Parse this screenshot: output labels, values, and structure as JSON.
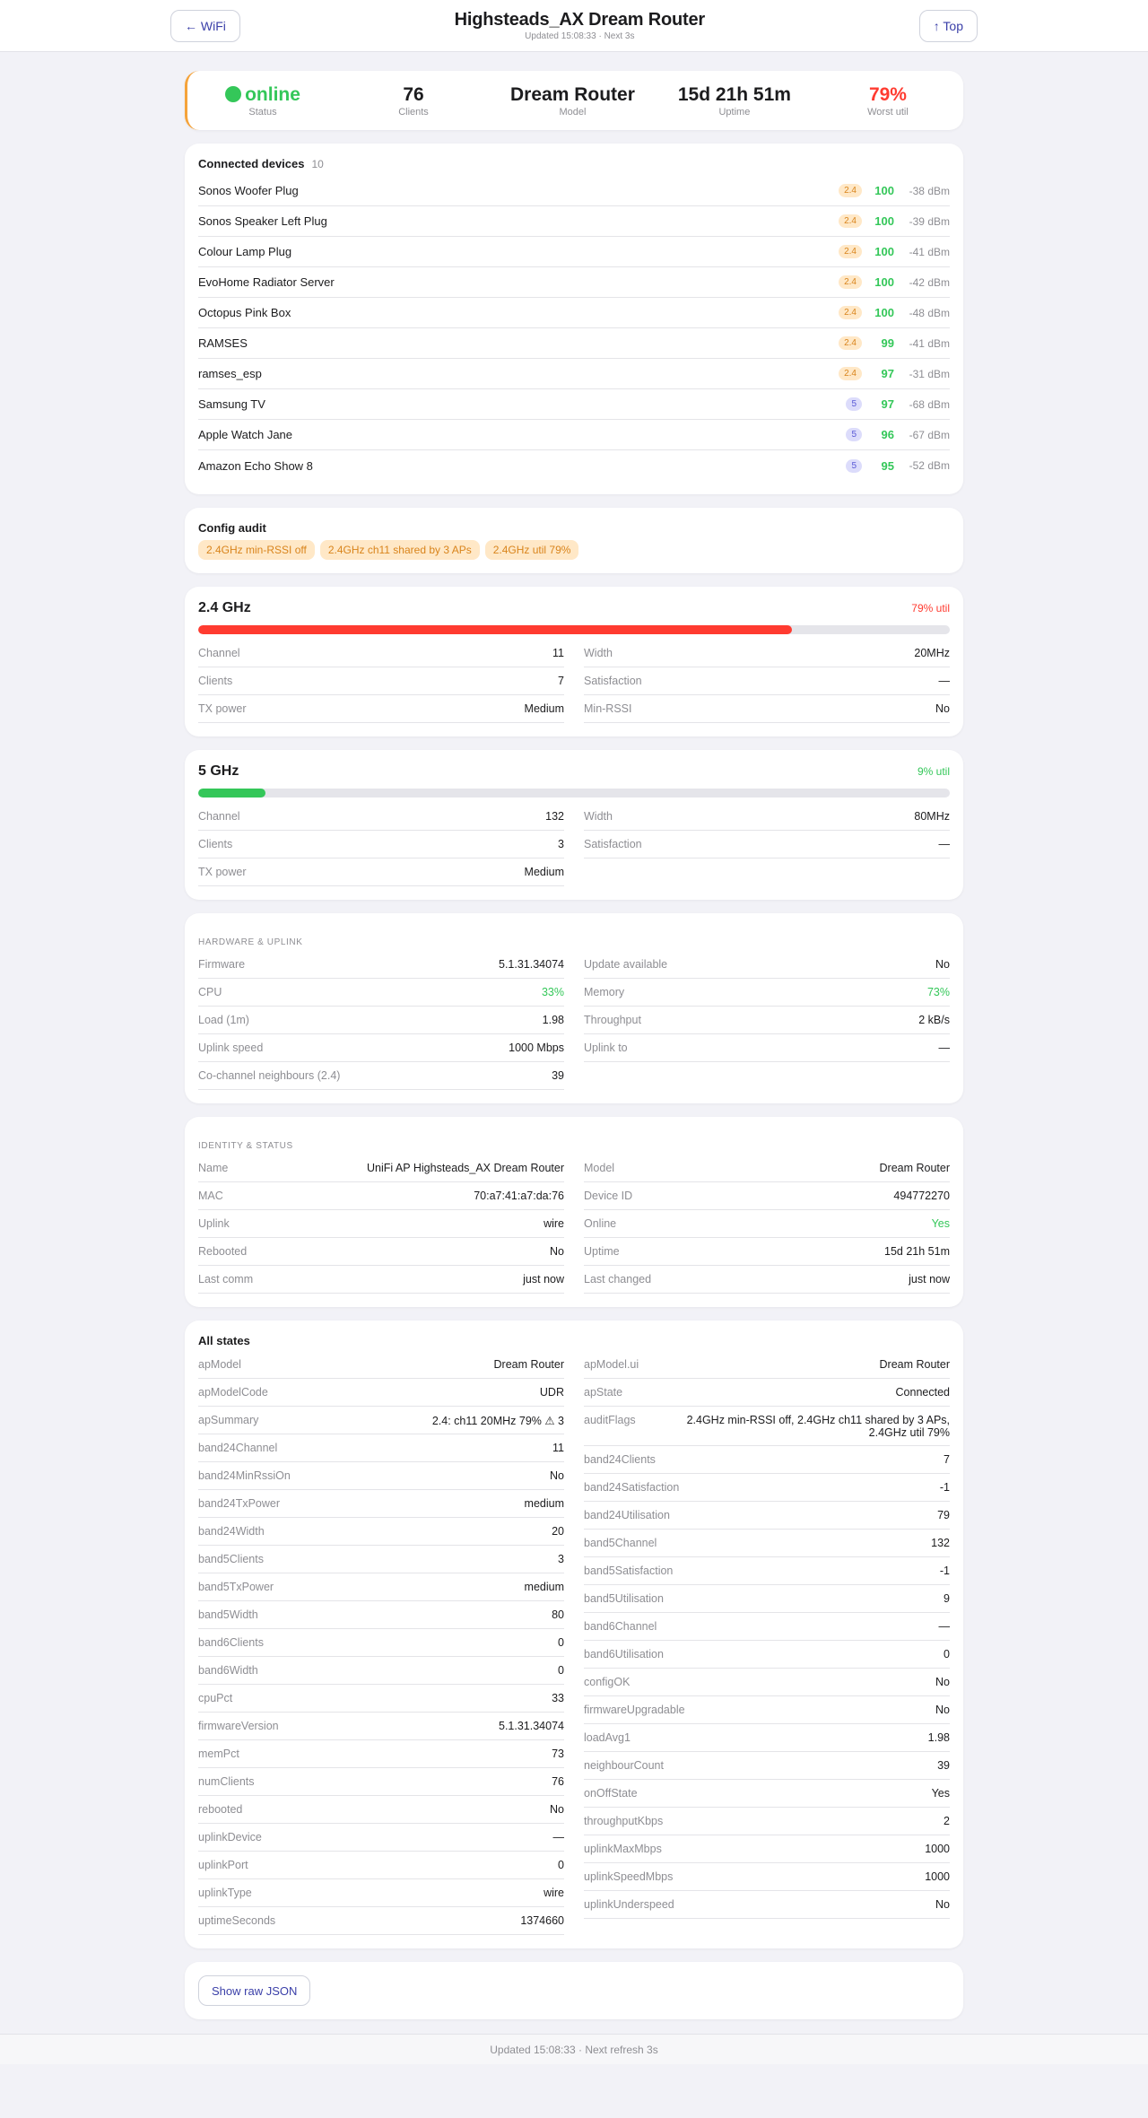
{
  "header": {
    "back_label": "← WiFi",
    "title": "Highsteads_AX Dream Router",
    "subtitle": "Updated 15:08:33 · Next 3s",
    "top_label": "↑ Top"
  },
  "summary": {
    "status_value": "online",
    "status_label": "Status",
    "clients_value": "76",
    "clients_label": "Clients",
    "model_value": "Dream Router",
    "model_label": "Model",
    "uptime_value": "15d 21h 51m",
    "uptime_label": "Uptime",
    "util_value": "79%",
    "util_label": "Worst util"
  },
  "devices": {
    "title": "Connected devices",
    "count": "10",
    "items": [
      {
        "name": "Sonos Woofer Plug",
        "band": "2.4",
        "sat": "100",
        "rssi": "-38 dBm"
      },
      {
        "name": "Sonos Speaker Left Plug",
        "band": "2.4",
        "sat": "100",
        "rssi": "-39 dBm"
      },
      {
        "name": "Colour Lamp Plug",
        "band": "2.4",
        "sat": "100",
        "rssi": "-41 dBm"
      },
      {
        "name": "EvoHome Radiator Server",
        "band": "2.4",
        "sat": "100",
        "rssi": "-42 dBm"
      },
      {
        "name": "Octopus Pink Box",
        "band": "2.4",
        "sat": "100",
        "rssi": "-48 dBm"
      },
      {
        "name": "RAMSES",
        "band": "2.4",
        "sat": "99",
        "rssi": "-41 dBm"
      },
      {
        "name": "ramses_esp",
        "band": "2.4",
        "sat": "97",
        "rssi": "-31 dBm"
      },
      {
        "name": "Samsung TV",
        "band": "5",
        "sat": "97",
        "rssi": "-68 dBm"
      },
      {
        "name": "Apple Watch Jane",
        "band": "5",
        "sat": "96",
        "rssi": "-67 dBm"
      },
      {
        "name": "Amazon Echo Show 8",
        "band": "5",
        "sat": "95",
        "rssi": "-52 dBm"
      }
    ]
  },
  "audit": {
    "title": "Config audit",
    "chips": [
      "2.4GHz min-RSSI off",
      "2.4GHz ch11 shared by 3 APs",
      "2.4GHz util 79%"
    ]
  },
  "band24": {
    "title": "2.4 GHz",
    "util_label": "79% util",
    "util_pct": 79,
    "bar_color": "#ff3b30",
    "left": [
      {
        "k": "Channel",
        "v": "11"
      },
      {
        "k": "Clients",
        "v": "7"
      },
      {
        "k": "TX power",
        "v": "Medium"
      }
    ],
    "right": [
      {
        "k": "Width",
        "v": "20MHz"
      },
      {
        "k": "Satisfaction",
        "v": "—"
      },
      {
        "k": "Min-RSSI",
        "v": "No"
      }
    ]
  },
  "band5": {
    "title": "5 GHz",
    "util_label": "9% util",
    "util_pct": 9,
    "bar_color": "#34c759",
    "left": [
      {
        "k": "Channel",
        "v": "132"
      },
      {
        "k": "Clients",
        "v": "3"
      },
      {
        "k": "TX power",
        "v": "Medium"
      }
    ],
    "right": [
      {
        "k": "Width",
        "v": "80MHz"
      },
      {
        "k": "Satisfaction",
        "v": "—"
      }
    ]
  },
  "hardware": {
    "title": "Hardware & uplink",
    "left": [
      {
        "k": "Firmware",
        "v": "5.1.31.34074"
      },
      {
        "k": "CPU",
        "v": "33%",
        "color": "#34c759"
      },
      {
        "k": "Load (1m)",
        "v": "1.98"
      },
      {
        "k": "Uplink speed",
        "v": "1000 Mbps"
      },
      {
        "k": "Co-channel neighbours (2.4)",
        "v": "39"
      }
    ],
    "right": [
      {
        "k": "Update available",
        "v": "No"
      },
      {
        "k": "Memory",
        "v": "73%",
        "color": "#34c759"
      },
      {
        "k": "Throughput",
        "v": "2 kB/s"
      },
      {
        "k": "Uplink to",
        "v": "—"
      }
    ]
  },
  "identity": {
    "title": "Identity & status",
    "left": [
      {
        "k": "Name",
        "v": "UniFi AP Highsteads_AX Dream Router"
      },
      {
        "k": "MAC",
        "v": "70:a7:41:a7:da:76"
      },
      {
        "k": "Uplink",
        "v": "wire"
      },
      {
        "k": "Rebooted",
        "v": "No"
      },
      {
        "k": "Last comm",
        "v": "just now"
      }
    ],
    "right": [
      {
        "k": "Model",
        "v": "Dream Router"
      },
      {
        "k": "Device ID",
        "v": "494772270"
      },
      {
        "k": "Online",
        "v": "Yes",
        "color": "#34c759"
      },
      {
        "k": "Uptime",
        "v": "15d 21h 51m"
      },
      {
        "k": "Last changed",
        "v": "just now"
      }
    ]
  },
  "states": {
    "title": "All states",
    "left": [
      {
        "k": "apModel",
        "v": "Dream Router"
      },
      {
        "k": "apModelCode",
        "v": "UDR"
      },
      {
        "k": "apSummary",
        "v": "2.4: ch11 20MHz 79% ⚠ 3"
      },
      {
        "k": "band24Channel",
        "v": "11"
      },
      {
        "k": "band24MinRssiOn",
        "v": "No"
      },
      {
        "k": "band24TxPower",
        "v": "medium"
      },
      {
        "k": "band24Width",
        "v": "20"
      },
      {
        "k": "band5Clients",
        "v": "3"
      },
      {
        "k": "band5TxPower",
        "v": "medium"
      },
      {
        "k": "band5Width",
        "v": "80"
      },
      {
        "k": "band6Clients",
        "v": "0"
      },
      {
        "k": "band6Width",
        "v": "0"
      },
      {
        "k": "cpuPct",
        "v": "33"
      },
      {
        "k": "firmwareVersion",
        "v": "5.1.31.34074"
      },
      {
        "k": "memPct",
        "v": "73"
      },
      {
        "k": "numClients",
        "v": "76"
      },
      {
        "k": "rebooted",
        "v": "No"
      },
      {
        "k": "uplinkDevice",
        "v": "—"
      },
      {
        "k": "uplinkPort",
        "v": "0"
      },
      {
        "k": "uplinkType",
        "v": "wire"
      },
      {
        "k": "uptimeSeconds",
        "v": "1374660"
      }
    ],
    "right": [
      {
        "k": "apModel.ui",
        "v": "Dream Router"
      },
      {
        "k": "apState",
        "v": "Connected"
      },
      {
        "k": "auditFlags",
        "v": "2.4GHz min-RSSI off, 2.4GHz ch11 shared by 3 APs, 2.4GHz util 79%"
      },
      {
        "k": "band24Clients",
        "v": "7"
      },
      {
        "k": "band24Satisfaction",
        "v": "-1"
      },
      {
        "k": "band24Utilisation",
        "v": "79"
      },
      {
        "k": "band5Channel",
        "v": "132"
      },
      {
        "k": "band5Satisfaction",
        "v": "-1"
      },
      {
        "k": "band5Utilisation",
        "v": "9"
      },
      {
        "k": "band6Channel",
        "v": "—"
      },
      {
        "k": "band6Utilisation",
        "v": "0"
      },
      {
        "k": "configOK",
        "v": "No"
      },
      {
        "k": "firmwareUpgradable",
        "v": "No"
      },
      {
        "k": "loadAvg1",
        "v": "1.98"
      },
      {
        "k": "neighbourCount",
        "v": "39"
      },
      {
        "k": "onOffState",
        "v": "Yes"
      },
      {
        "k": "throughputKbps",
        "v": "2"
      },
      {
        "k": "uplinkMaxMbps",
        "v": "1000"
      },
      {
        "k": "uplinkSpeedMbps",
        "v": "1000"
      },
      {
        "k": "uplinkUnderspeed",
        "v": "No"
      }
    ]
  },
  "raw_button": "Show raw JSON",
  "footer": "Updated 15:08:33 · Next refresh 3s"
}
